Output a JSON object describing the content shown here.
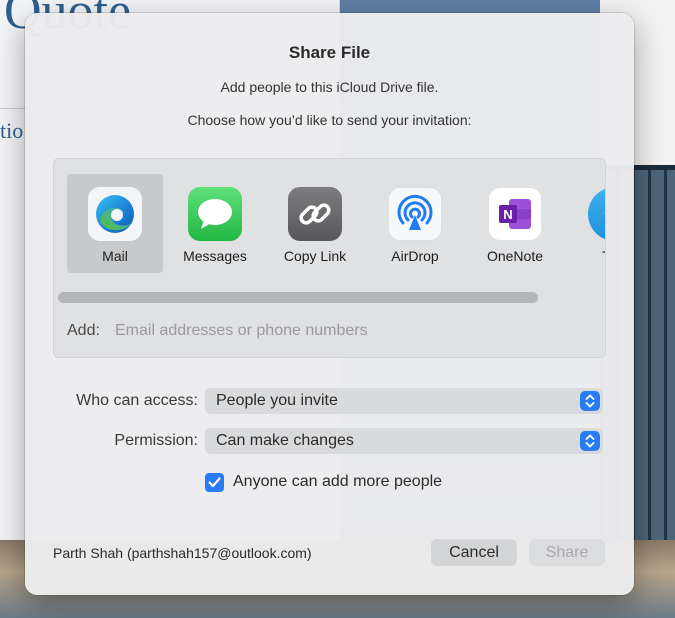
{
  "background": {
    "logo_text": "Quote",
    "side_text": "tio"
  },
  "dialog": {
    "title": "Share File",
    "subtitle": "Add people to this iCloud Drive file.",
    "instruction": "Choose how you’d like to send your invitation:"
  },
  "share_options": [
    {
      "label": "Mail",
      "icon": "edge-icon",
      "selected": true
    },
    {
      "label": "Messages",
      "icon": "messages-icon",
      "selected": false
    },
    {
      "label": "Copy Link",
      "icon": "link-icon",
      "selected": false
    },
    {
      "label": "AirDrop",
      "icon": "airdrop-icon",
      "selected": false
    },
    {
      "label": "OneNote",
      "icon": "onenote-icon",
      "selected": false
    },
    {
      "label": "Tele",
      "icon": "telegram-icon",
      "selected": false
    }
  ],
  "add": {
    "label": "Add:",
    "placeholder": "Email addresses or phone numbers"
  },
  "access": {
    "label": "Who can access:",
    "value": "People you invite"
  },
  "permission": {
    "label": "Permission:",
    "value": "Can make changes"
  },
  "allow_add": {
    "label": "Anyone can add more people",
    "checked": true
  },
  "account": "Parth Shah (parthshah157@outlook.com)",
  "buttons": {
    "cancel": "Cancel",
    "share": "Share"
  },
  "colors": {
    "accent": "#2a7cf6",
    "messages": "#34c759",
    "onenote": "#7b2fbf"
  }
}
